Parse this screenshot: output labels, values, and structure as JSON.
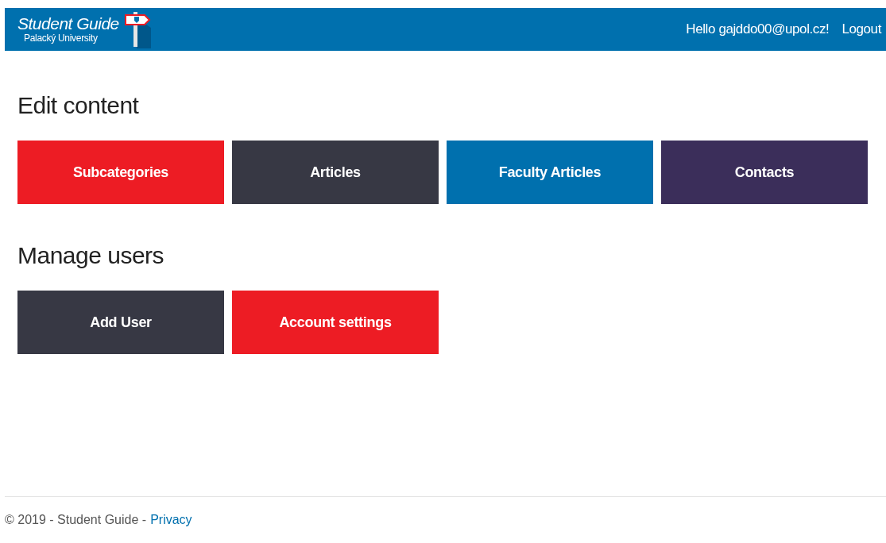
{
  "header": {
    "brand_title": "Student Guide",
    "brand_subtitle": "Palacký University",
    "greeting": "Hello gajddo00@upol.cz!",
    "logout": "Logout"
  },
  "sections": [
    {
      "title": "Edit content",
      "buttons": [
        {
          "label": "Subcategories",
          "color": "#ed1c24"
        },
        {
          "label": "Articles",
          "color": "#373844"
        },
        {
          "label": "Faculty Articles",
          "color": "#0070ae"
        },
        {
          "label": "Contacts",
          "color": "#3b2e5a"
        }
      ]
    },
    {
      "title": "Manage users",
      "buttons": [
        {
          "label": "Add User",
          "color": "#373844"
        },
        {
          "label": "Account settings",
          "color": "#ed1c24"
        }
      ]
    }
  ],
  "footer": {
    "text": "© 2019 - Student Guide -",
    "link": "Privacy"
  }
}
